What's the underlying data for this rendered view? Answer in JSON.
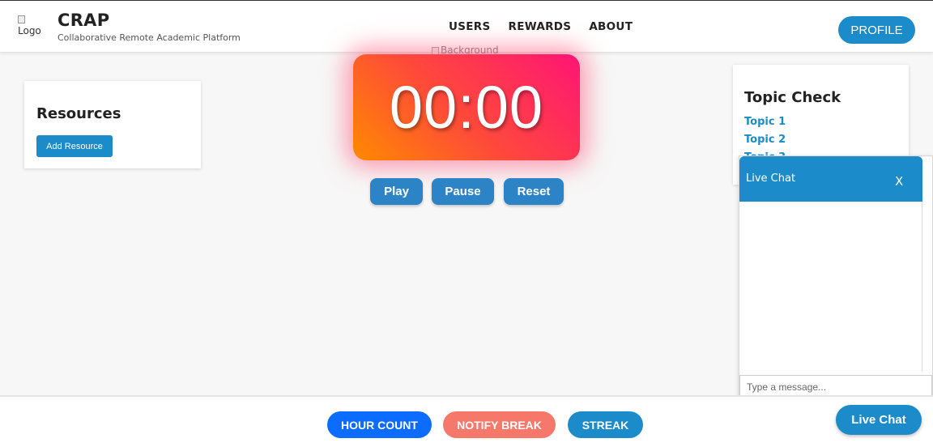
{
  "header": {
    "logo_alt": "Logo",
    "title": "CRAP",
    "subtitle": "Collaborative Remote Academic Platform",
    "nav": [
      "USERS",
      "REWARDS",
      "ABOUT"
    ],
    "profile_label": "PROFILE"
  },
  "background_alt": "Background",
  "resources": {
    "title": "Resources",
    "add_label": "Add Resource"
  },
  "timer": {
    "display": "00:00",
    "play_label": "Play",
    "pause_label": "Pause",
    "reset_label": "Reset"
  },
  "topic_check": {
    "title": "Topic Check",
    "topics": [
      "Topic 1",
      "Topic 2",
      "Topic 3"
    ]
  },
  "chat": {
    "title": "Live Chat",
    "close_label": "X",
    "input_placeholder": "Type a message...",
    "toggle_label": "Live Chat"
  },
  "footer": {
    "hour_count_label": "HOUR COUNT",
    "notify_break_label": "NOTIFY BREAK",
    "streak_label": "STREAK"
  },
  "colors": {
    "primary": "#1b8bc9",
    "hour_count": "#0b6cff",
    "notify_break": "#f6786a",
    "streak": "#1b8bc9"
  }
}
